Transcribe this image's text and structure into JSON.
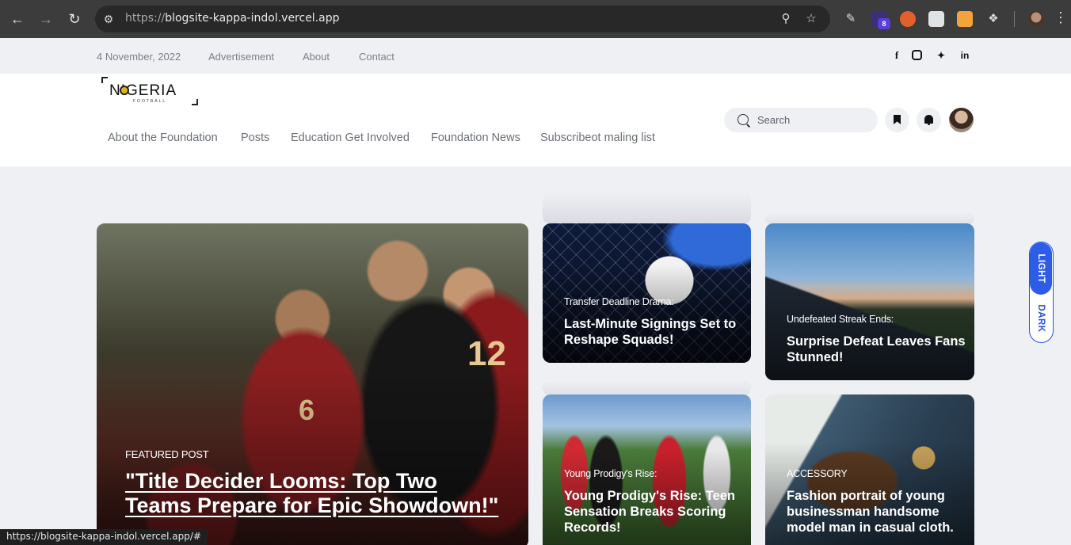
{
  "browser": {
    "url_protocol": "https://",
    "url_host": "blogsite-kappa-indol.vercel.app",
    "extension_badge": "8",
    "status_url": "https://blogsite-kappa-indol.vercel.app/#"
  },
  "topbar": {
    "date": "4 November, 2022",
    "links": [
      "Advertisement",
      "About",
      "Contact"
    ],
    "social": [
      "f",
      "ig",
      "tw",
      "in"
    ]
  },
  "header": {
    "logo_text": "NIGERIA",
    "logo_sub": "FOOTBALL",
    "nav": [
      "About the Foundation",
      "Posts",
      "Education Get Involved",
      "Foundation News",
      "Subscribeot maling list"
    ],
    "search_placeholder": "Search"
  },
  "featured": {
    "category": "FEATURED POST",
    "title": "\"Title Decider Looms: Top Two Teams Prepare for Epic Showdown!\"",
    "jersey_numbers": [
      "12",
      "6"
    ]
  },
  "cards": [
    {
      "category": "Transfer Deadline Drama:",
      "title": "Last-Minute Signings Set to Reshape Squads!"
    },
    {
      "category": "Undefeated Streak Ends:",
      "title": "Surprise Defeat Leaves Fans Stunned!"
    },
    {
      "category": "Young Prodigy's Rise:",
      "title": "Young Prodigy's Rise: Teen Sensation Breaks Scoring Records!"
    },
    {
      "category": "ACCESSORY",
      "title": "Fashion portrait of young businessman handsome model man in casual cloth."
    }
  ],
  "theme_toggle": {
    "light": "LIGHT",
    "dark": "DARK"
  },
  "icons": {
    "back": "arrow-left-icon",
    "forward": "arrow-right-icon",
    "reload": "reload-icon",
    "zoom": "zoom-icon",
    "star": "star-icon",
    "extensions": "puzzle-icon",
    "search": "search-icon",
    "bookmark": "bookmark-icon",
    "bell": "bell-icon"
  },
  "colors": {
    "accent": "#2d5de8",
    "chrome": "#3c3c3c",
    "page_bg": "#eef0f4"
  }
}
